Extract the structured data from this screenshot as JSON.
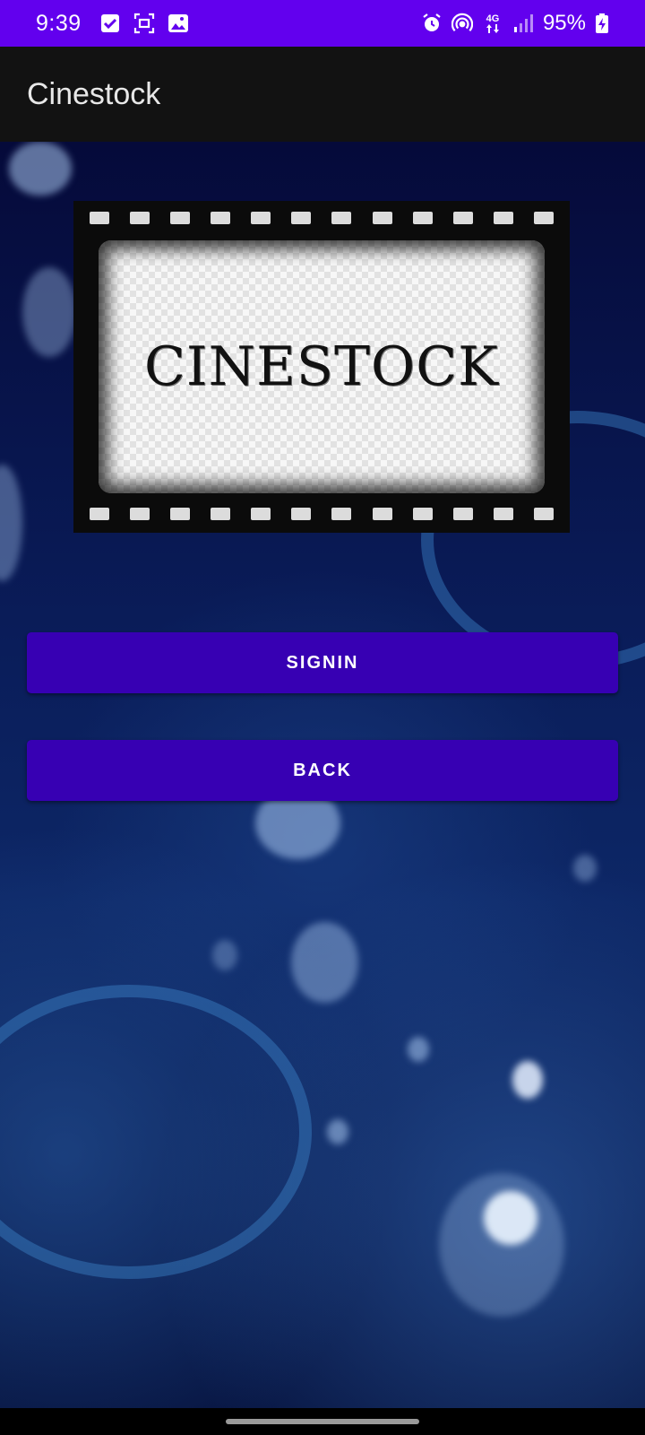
{
  "status_bar": {
    "time": "9:39",
    "battery": "95%",
    "network": "4G",
    "background": "#6200ee",
    "left_icons": [
      "check-icon",
      "screenshot-icon",
      "gallery-icon"
    ],
    "right_icons": [
      "alarm-icon",
      "hotspot-icon",
      "network-4g-icon",
      "signal-icon",
      "battery-charging-icon"
    ]
  },
  "app_bar": {
    "title": "Cinestock",
    "background": "#121212"
  },
  "logo": {
    "text": "CINESTOCK"
  },
  "buttons": {
    "signin_label": "SIGNIN",
    "back_label": "BACK",
    "color": "#3700b3"
  }
}
